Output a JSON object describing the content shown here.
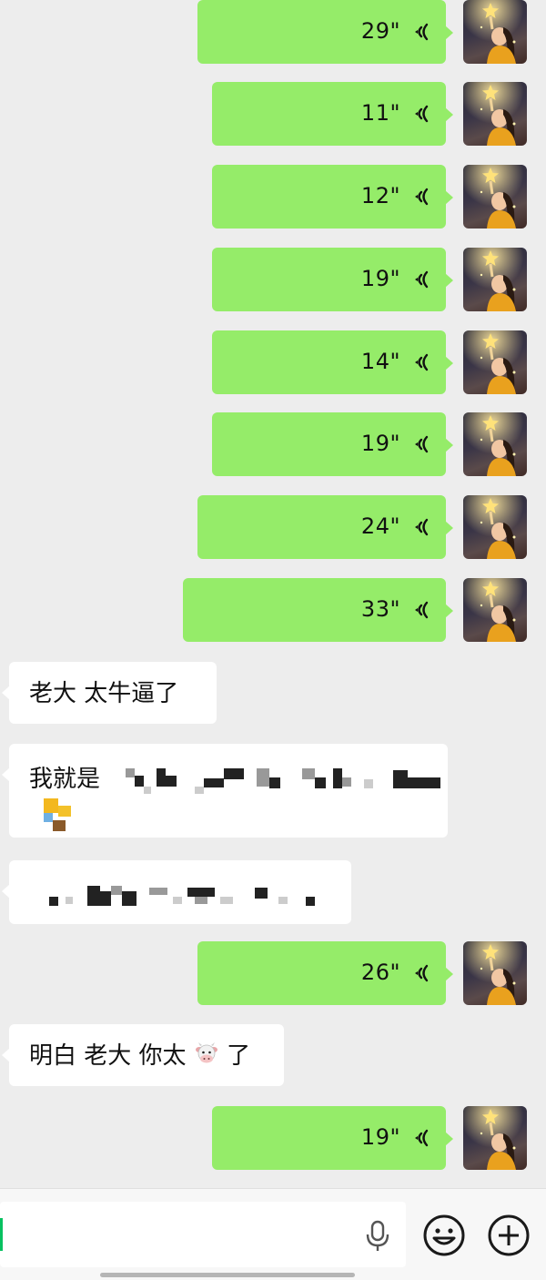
{
  "chat": {
    "voice_out": [
      "29\"",
      "11\"",
      "12\"",
      "19\"",
      "14\"",
      "19\"",
      "24\"",
      "33\"",
      "26\"",
      "19\""
    ],
    "text_in": {
      "m1": "老大 太牛逼了",
      "m2_prefix": "我就是",
      "m4": "明白 老大 你太",
      "m4_suffix": "了"
    }
  },
  "icons": {
    "voice": "voice-wave-icon",
    "mic": "microphone-icon",
    "emoji": "smiley-icon",
    "plus": "plus-icon",
    "cow": "cow-emoji-icon"
  },
  "colors": {
    "bg": "#ededed",
    "outgoing": "#95ec69",
    "incoming": "#ffffff",
    "accent": "#07c160"
  }
}
